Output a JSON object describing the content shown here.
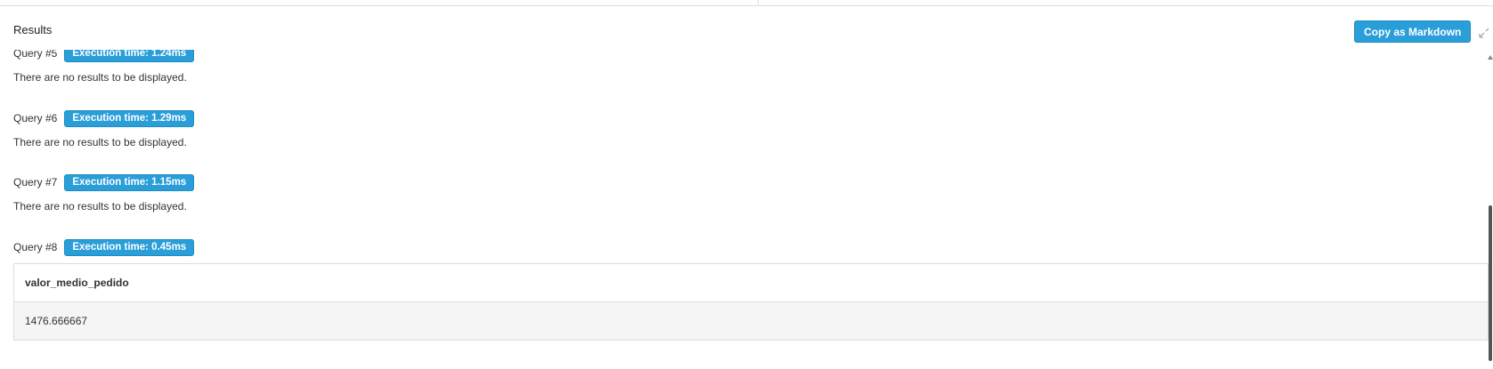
{
  "results_panel": {
    "title": "Results",
    "copy_button_label": "Copy as Markdown",
    "expand_icon": "collapse-arrows-icon"
  },
  "queries": [
    {
      "label": "Query #5",
      "execution_time": "Execution time: 1.24ms",
      "message": "There are no results to be displayed."
    },
    {
      "label": "Query #6",
      "execution_time": "Execution time: 1.29ms",
      "message": "There are no results to be displayed."
    },
    {
      "label": "Query #7",
      "execution_time": "Execution time: 1.15ms",
      "message": "There are no results to be displayed."
    },
    {
      "label": "Query #8",
      "execution_time": "Execution time: 0.45ms",
      "table": {
        "columns": [
          "valor_medio_pedido"
        ],
        "rows": [
          [
            "1476.666667"
          ]
        ]
      }
    }
  ],
  "colors": {
    "accent": "#2a9ed9",
    "table_row_bg": "#f5f5f5",
    "border": "#dddddd"
  }
}
